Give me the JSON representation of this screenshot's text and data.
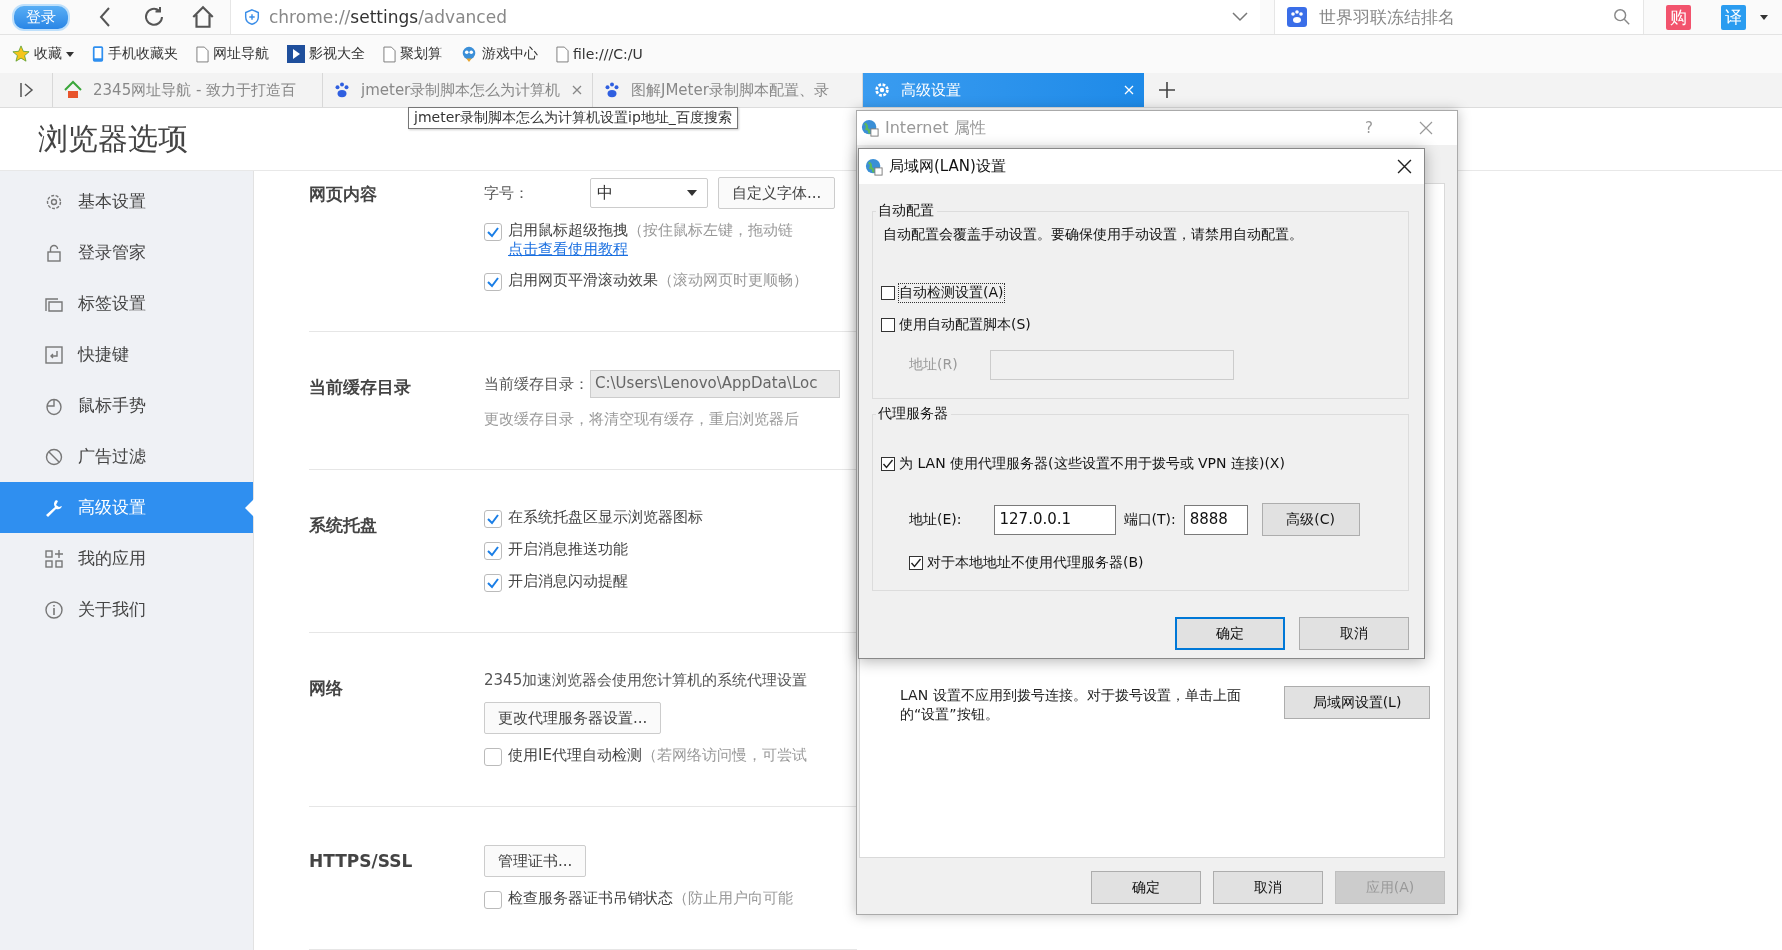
{
  "toolbar": {
    "login_badge": "登录",
    "address": {
      "scheme": "chrome://",
      "host": "settings",
      "path": "/advanced"
    },
    "search": {
      "placeholder": "世界羽联冻结排名"
    },
    "shop_button": "购",
    "translate_button": "译"
  },
  "bookmarks": [
    {
      "label": "收藏",
      "kind": "star"
    },
    {
      "label": "手机收藏夹",
      "kind": "phone"
    },
    {
      "label": "网址导航",
      "kind": "page"
    },
    {
      "label": "影视大全",
      "kind": "film"
    },
    {
      "label": "聚划算",
      "kind": "page"
    },
    {
      "label": "游戏中心",
      "kind": "mascot"
    },
    {
      "label": "file:///C:/U",
      "kind": "page"
    }
  ],
  "tabs": [
    {
      "title": "2345网址导航 - 致力于打造百",
      "selected": false,
      "closable": false,
      "kind": "house"
    },
    {
      "title": "jmeter录制脚本怎么为计算机",
      "selected": false,
      "closable": true,
      "kind": "paw"
    },
    {
      "title": "图解JMeter录制脚本配置、录",
      "selected": false,
      "closable": false,
      "kind": "paw"
    },
    {
      "title": "高级设置",
      "selected": true,
      "closable": true,
      "kind": "gear"
    }
  ],
  "tooltip": "jmeter录制脚本怎么为计算机设置ip地址_百度搜索",
  "settings": {
    "title": "浏览器选项",
    "nav": [
      {
        "label": "基本设置",
        "selected": false
      },
      {
        "label": "登录管家",
        "selected": false
      },
      {
        "label": "标签设置",
        "selected": false
      },
      {
        "label": "快捷键",
        "selected": false
      },
      {
        "label": "鼠标手势",
        "selected": false
      },
      {
        "label": "广告过滤",
        "selected": false
      },
      {
        "label": "高级设置",
        "selected": true
      },
      {
        "label": "我的应用",
        "selected": false
      },
      {
        "label": "关于我们",
        "selected": false
      }
    ],
    "sections": [
      {
        "title": "网页内容",
        "rows": [
          {
            "kind": "select",
            "label": "字号：",
            "value": "中",
            "button": "自定义字体..."
          },
          {
            "kind": "checkbox",
            "label": "启用鼠标超级拖拽",
            "hint": "（按住鼠标左键，拖动链",
            "checked": true,
            "link": "点击查看使用教程"
          },
          {
            "kind": "checkbox",
            "label": "启用网页平滑滚动效果",
            "hint": "（滚动网页时更顺畅）",
            "checked": true
          }
        ]
      },
      {
        "title": "当前缓存目录",
        "rows": [
          {
            "kind": "path",
            "label": "当前缓存目录：",
            "value": "C:\\Users\\Lenovo\\AppData\\Loc"
          },
          {
            "kind": "note",
            "text": "更改缓存目录，将清空现有缓存，重启浏览器后"
          }
        ]
      },
      {
        "title": "系统托盘",
        "rows": [
          {
            "kind": "checkbox",
            "label": "在系统托盘区显示浏览器图标",
            "checked": true
          },
          {
            "kind": "checkbox",
            "label": "开启消息推送功能",
            "checked": true
          },
          {
            "kind": "checkbox",
            "label": "开启消息闪动提醒",
            "checked": true
          }
        ]
      },
      {
        "title": "网络",
        "rows": [
          {
            "kind": "text",
            "text": "2345加速浏览器会使用您计算机的系统代理设置"
          },
          {
            "kind": "button",
            "label": "更改代理服务器设置..."
          },
          {
            "kind": "checkbox",
            "label": "使用IE代理自动检测",
            "hint": "（若网络访问慢，可尝试",
            "checked": false
          }
        ]
      },
      {
        "title": "HTTPS/SSL",
        "rows": [
          {
            "kind": "button",
            "label": "管理证书..."
          },
          {
            "kind": "checkbox",
            "label": "检查服务器证书吊销状态",
            "hint": "（防止用户向可能",
            "checked": false
          }
        ]
      }
    ]
  },
  "internet_properties": {
    "title": "Internet 属性",
    "help": "?",
    "lan_text": "LAN 设置不应用到拨号连接。对于拨号设置，单击上面的“设置”按钮。",
    "lan_button": "局域网设置(L)",
    "buttons": [
      {
        "label": "确定",
        "disabled": false
      },
      {
        "label": "取消",
        "disabled": false
      },
      {
        "label": "应用(A)",
        "disabled": true
      }
    ]
  },
  "lan_dialog": {
    "title": "局域网(LAN)设置",
    "auto_group": {
      "title": "自动配置",
      "description": "自动配置会覆盖手动设置。要确保使用手动设置，请禁用自动配置。",
      "options": [
        {
          "label": "自动检测设置(A)",
          "checked": false,
          "focused": true
        },
        {
          "label": "使用自动配置脚本(S)",
          "checked": false,
          "focused": false
        }
      ],
      "address_label": "地址(R)",
      "address_disabled": true
    },
    "proxy_group": {
      "title": "代理服务器",
      "use_proxy": {
        "label": "为 LAN 使用代理服务器(这些设置不用于拨号或 VPN 连接)(X)",
        "checked": true
      },
      "address_label": "地址(E):",
      "address": "127.0.0.1",
      "port_label": "端口(T):",
      "port": "8888",
      "advanced_button": "高级(C)",
      "bypass": {
        "label": "对于本地地址不使用代理服务器(B)",
        "checked": true
      }
    },
    "buttons": [
      {
        "label": "确定",
        "default": true
      },
      {
        "label": "取消",
        "default": false
      }
    ]
  }
}
